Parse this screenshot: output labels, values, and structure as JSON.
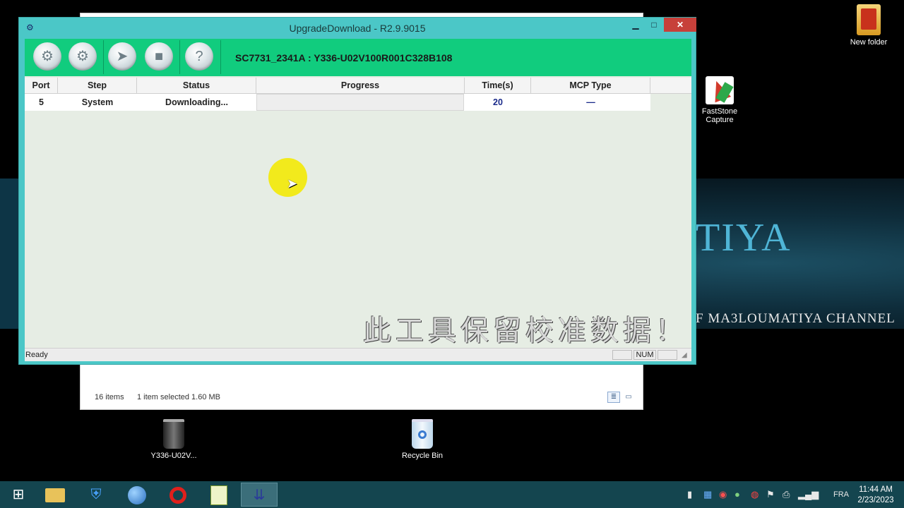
{
  "desktop": {
    "wallpaper_title": "TIYA",
    "wallpaper_sub": "F MA3LOUMATIYA CHANNEL",
    "icons": {
      "new_folder": "New folder",
      "faststone_line1": "FastStone",
      "faststone_line2": "Capture",
      "firmware": "Y336-U02V...",
      "recycle_bin": "Recycle Bin"
    }
  },
  "explorer": {
    "items_count": "16 items",
    "selection": "1 item selected  1.60 MB"
  },
  "app": {
    "title": "UpgradeDownload - R2.9.9015",
    "device": "SC7731_2341A : Y336-U02V100R001C328B108",
    "columns": [
      "Port",
      "Step",
      "Status",
      "Progress",
      "Time(s)",
      "MCP Type"
    ],
    "rows": [
      {
        "port": "5",
        "step": "System",
        "status": "Downloading...",
        "progress": 0.0,
        "time": "20",
        "mcp": "—"
      }
    ],
    "watermark": "此工具保留校准数据！",
    "statusbar": {
      "ready": "Ready",
      "num": "NUM"
    }
  },
  "taskbar": {
    "language": "FRA",
    "time": "11:44 AM",
    "date": "2/23/2023"
  }
}
